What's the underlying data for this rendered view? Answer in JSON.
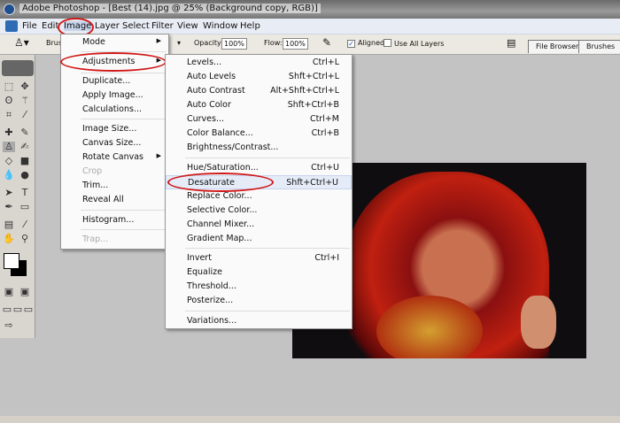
{
  "title": "Adobe Photoshop - [Best (14).jpg @ 25% (Background copy, RGB)]",
  "menubar": [
    "File",
    "Edit",
    "Image",
    "Layer",
    "Select",
    "Filter",
    "View",
    "Window",
    "Help"
  ],
  "options": {
    "brush_label": "Brus",
    "opacity_label": "Opacity:",
    "opacity": "100%",
    "flow_label": "Flow:",
    "flow": "100%",
    "aligned": "Aligned",
    "use_all_layers": "Use All Layers",
    "tabs": [
      "File Browser",
      "Brushes"
    ]
  },
  "image_menu": [
    {
      "label": "Mode",
      "submenu": true
    },
    {
      "label": "Adjustments",
      "submenu": true
    },
    {
      "label": "Duplicate..."
    },
    {
      "label": "Apply Image..."
    },
    {
      "label": "Calculations..."
    },
    {
      "label": "Image Size..."
    },
    {
      "label": "Canvas Size..."
    },
    {
      "label": "Rotate Canvas",
      "submenu": true
    },
    {
      "label": "Crop",
      "disabled": true
    },
    {
      "label": "Trim..."
    },
    {
      "label": "Reveal All"
    },
    {
      "label": "Histogram..."
    },
    {
      "label": "Trap...",
      "disabled": true
    }
  ],
  "adjustments_menu": [
    {
      "label": "Levels...",
      "shortcut": "Ctrl+L"
    },
    {
      "label": "Auto Levels",
      "shortcut": "Shft+Ctrl+L"
    },
    {
      "label": "Auto Contrast",
      "shortcut": "Alt+Shft+Ctrl+L"
    },
    {
      "label": "Auto Color",
      "shortcut": "Shft+Ctrl+B"
    },
    {
      "label": "Curves...",
      "shortcut": "Ctrl+M"
    },
    {
      "label": "Color Balance...",
      "shortcut": "Ctrl+B"
    },
    {
      "label": "Brightness/Contrast...",
      "shortcut": ""
    },
    {
      "label": "Hue/Saturation...",
      "shortcut": "Ctrl+U"
    },
    {
      "label": "Desaturate",
      "shortcut": "Shft+Ctrl+U"
    },
    {
      "label": "Replace Color...",
      "shortcut": ""
    },
    {
      "label": "Selective Color...",
      "shortcut": ""
    },
    {
      "label": "Channel Mixer...",
      "shortcut": ""
    },
    {
      "label": "Gradient Map...",
      "shortcut": ""
    },
    {
      "label": "Invert",
      "shortcut": "Ctrl+I"
    },
    {
      "label": "Equalize",
      "shortcut": ""
    },
    {
      "label": "Threshold...",
      "shortcut": ""
    },
    {
      "label": "Posterize...",
      "shortcut": ""
    },
    {
      "label": "Variations...",
      "shortcut": ""
    }
  ],
  "highlight_color": "#d01818"
}
